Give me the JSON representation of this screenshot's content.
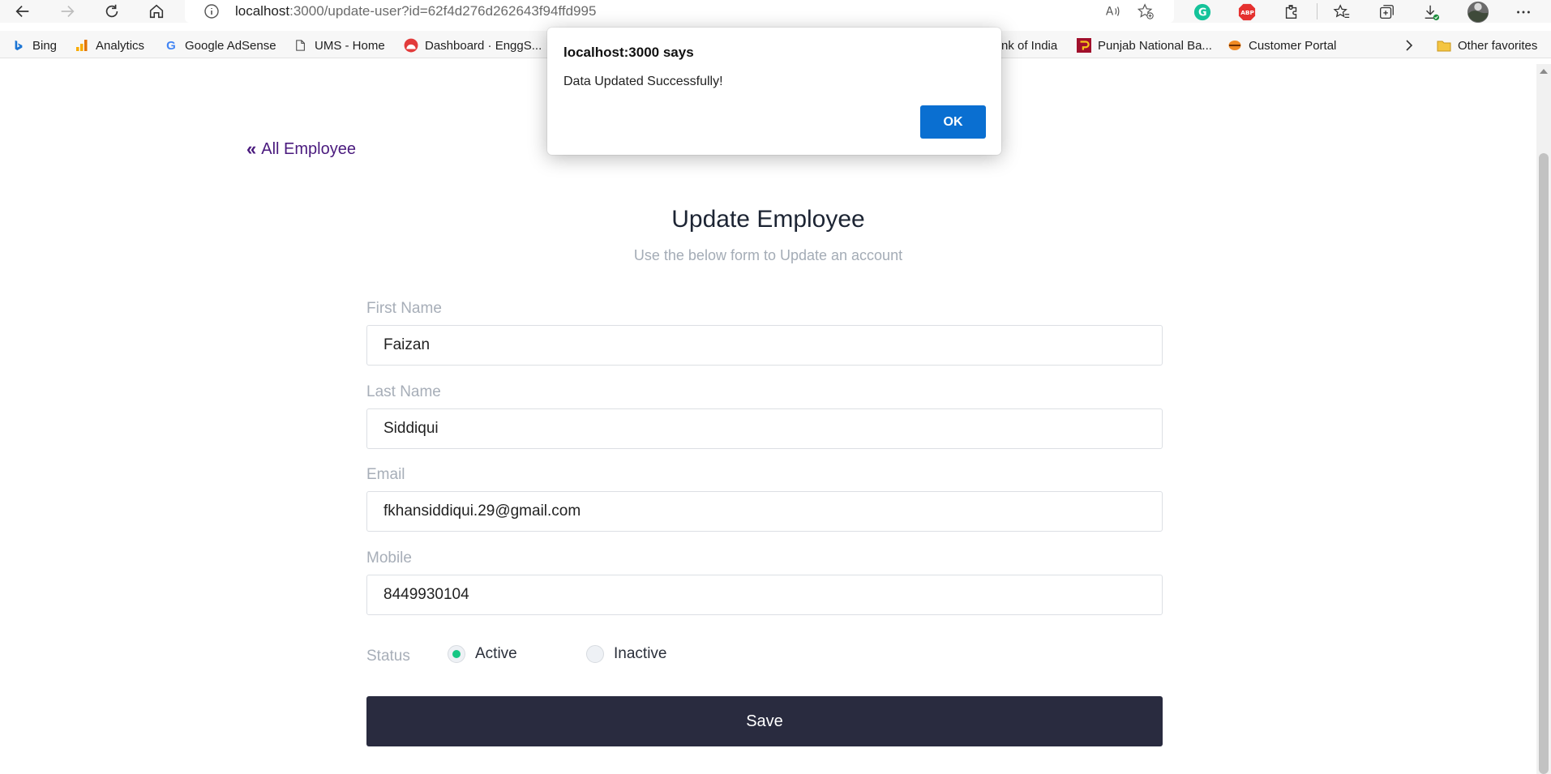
{
  "browser": {
    "url_host": "localhost",
    "url_rest": ":3000/update-user?id=62f4d276d262643f94ffd995"
  },
  "bookmarks": [
    {
      "label": "Bing",
      "icon": "bing-icon"
    },
    {
      "label": "Analytics",
      "icon": "analytics-icon"
    },
    {
      "label": "Google AdSense",
      "icon": "google-icon"
    },
    {
      "label": "UMS - Home",
      "icon": "page-icon"
    },
    {
      "label": "Dashboard · EnggS...",
      "icon": "dashboard-icon"
    },
    {
      "label": "nk of India",
      "icon": "bank-icon"
    },
    {
      "label": "Punjab National Ba...",
      "icon": "pnb-icon"
    },
    {
      "label": "Customer Portal",
      "icon": "portal-icon"
    },
    {
      "label": "Other favorites",
      "icon": "folder-icon"
    }
  ],
  "page": {
    "back_link": "All Employee",
    "title": "Update Employee",
    "subtitle": "Use the below form to Update an account",
    "fields": {
      "first_name": {
        "label": "First Name",
        "value": "Faizan"
      },
      "last_name": {
        "label": "Last Name",
        "value": "Siddiqui"
      },
      "email": {
        "label": "Email",
        "value": "fkhansiddiqui.29@gmail.com"
      },
      "mobile": {
        "label": "Mobile",
        "value": "8449930104"
      }
    },
    "status": {
      "label": "Status",
      "options": [
        "Active",
        "Inactive"
      ],
      "selected": "Active"
    },
    "save_label": "Save"
  },
  "dialog": {
    "title": "localhost:3000 says",
    "message": "Data Updated Successfully!",
    "ok_label": "OK"
  },
  "colors": {
    "accent_link": "#4a1a7e",
    "save_button": "#292b3f",
    "radio_selected": "#16c784",
    "dialog_ok": "#0a6fd1"
  }
}
